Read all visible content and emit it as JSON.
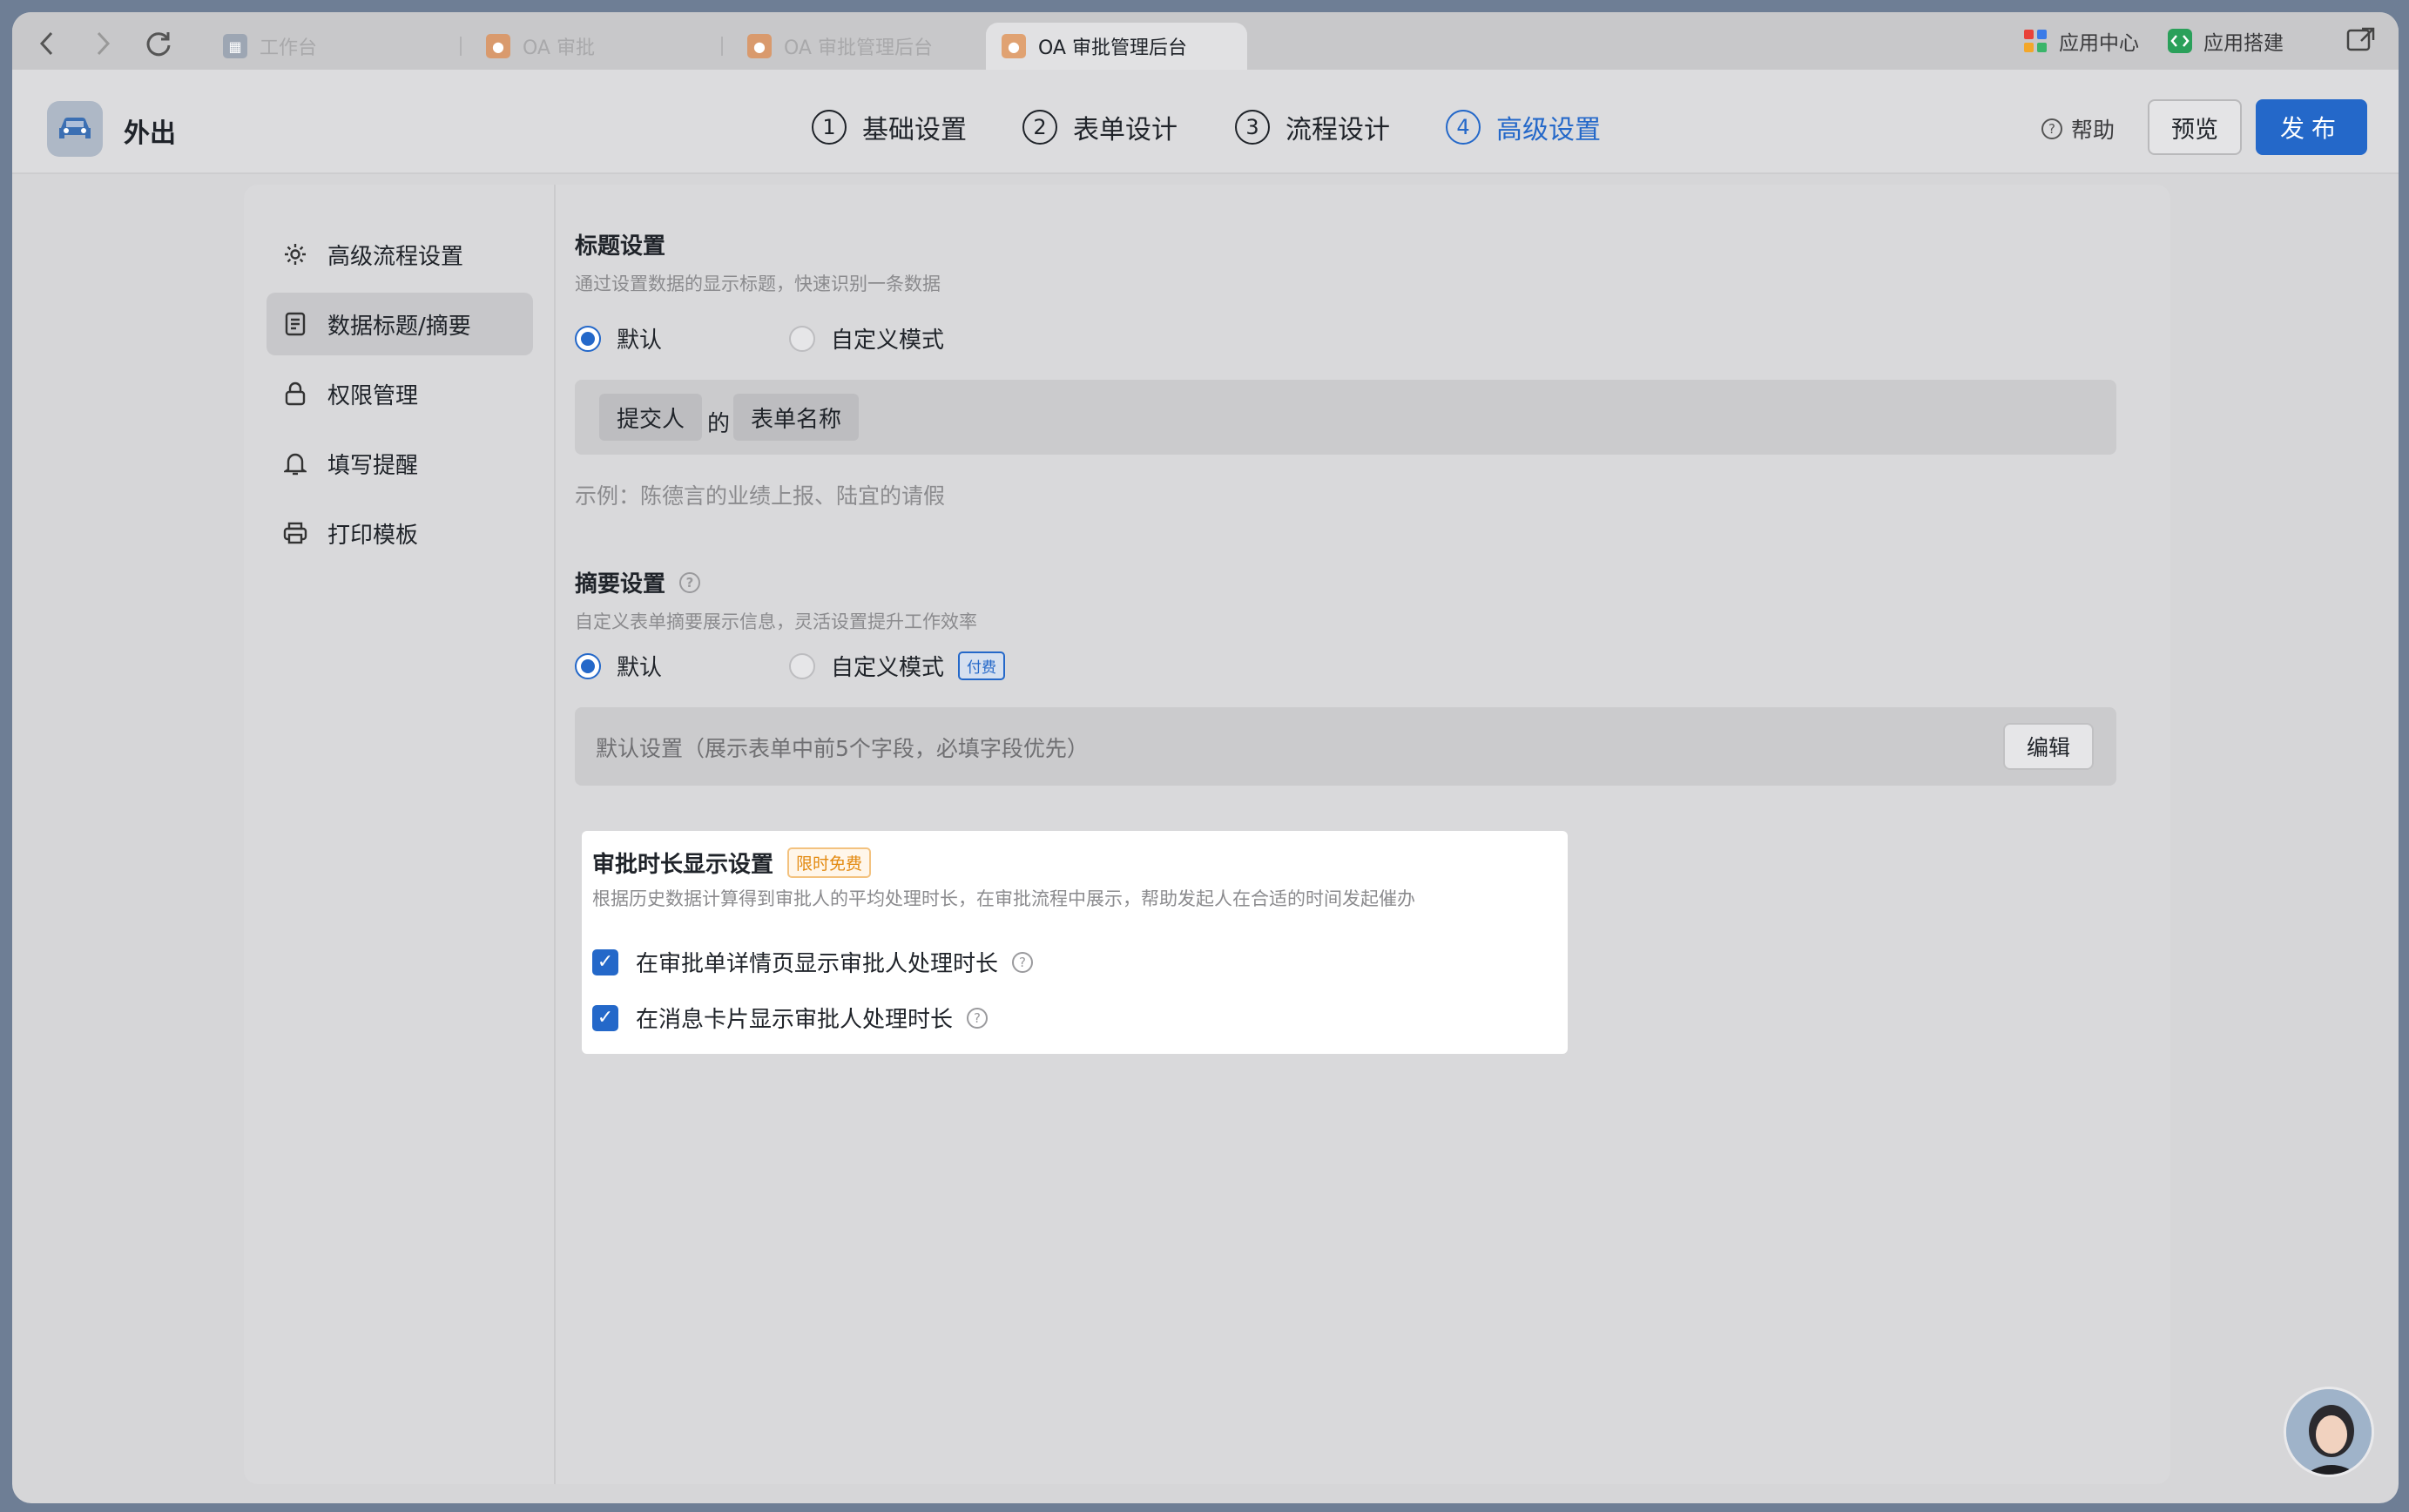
{
  "tabs": [
    {
      "label": "工作台",
      "active": false
    },
    {
      "label": "OA 审批",
      "active": false
    },
    {
      "label": "OA 审批管理后台",
      "active": false
    },
    {
      "label": "OA 审批管理后台",
      "active": true
    }
  ],
  "tabbar_right": {
    "app_center": "应用中心",
    "app_build": "应用搭建"
  },
  "header": {
    "app_title": "外出",
    "steps": [
      {
        "num": "1",
        "label": "基础设置"
      },
      {
        "num": "2",
        "label": "表单设计"
      },
      {
        "num": "3",
        "label": "流程设计"
      },
      {
        "num": "4",
        "label": "高级设置"
      }
    ],
    "help": "帮助",
    "preview": "预览",
    "publish": "发布"
  },
  "sidebar": {
    "items": [
      {
        "label": "高级流程设置",
        "icon": "gear-icon"
      },
      {
        "label": "数据标题/摘要",
        "icon": "document-icon",
        "active": true
      },
      {
        "label": "权限管理",
        "icon": "lock-icon"
      },
      {
        "label": "填写提醒",
        "icon": "bell-icon"
      },
      {
        "label": "打印模板",
        "icon": "printer-icon"
      }
    ]
  },
  "title_settings": {
    "title": "标题设置",
    "desc": "通过设置数据的显示标题，快速识别一条数据",
    "option_default": "默认",
    "option_custom": "自定义模式",
    "chip_submitter": "提交人",
    "connector": "的",
    "chip_form_name": "表单名称",
    "example": "示例：陈德言的业绩上报、陆宜的请假"
  },
  "summary_settings": {
    "title": "摘要设置",
    "desc": "自定义表单摘要展示信息，灵活设置提升工作效率",
    "option_default": "默认",
    "option_custom": "自定义模式",
    "paid_badge": "付费",
    "default_text": "默认设置（展示表单中前5个字段，必填字段优先）",
    "edit": "编辑"
  },
  "duration_settings": {
    "title": "审批时长显示设置",
    "badge": "限时免费",
    "desc": "根据历史数据计算得到审批人的平均处理时长，在审批流程中展示，帮助发起人在合适的时间发起催办",
    "check_detail": "在审批单详情页显示审批人处理时长",
    "check_card": "在消息卡片显示审批人处理时长"
  },
  "colors": {
    "accent": "#2468c9",
    "free_badge": "#e38a11"
  }
}
